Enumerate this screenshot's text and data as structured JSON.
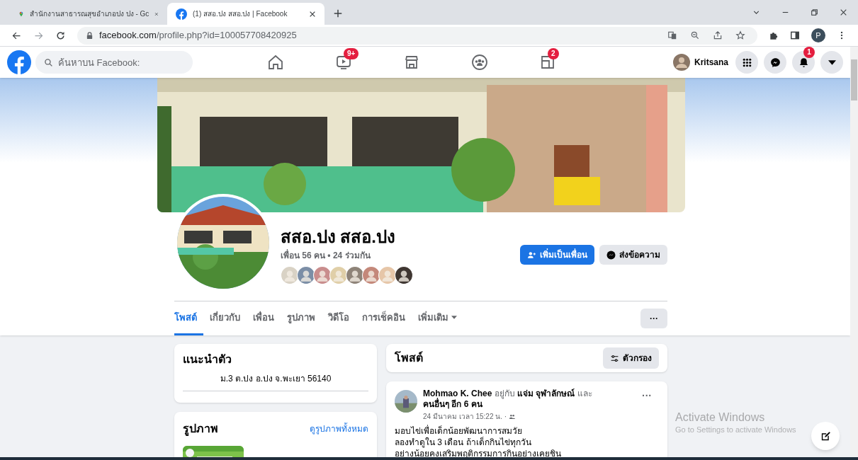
{
  "browser": {
    "tabs": [
      {
        "title": "สำนักงานสาธารณสุขอำเภอปง ปง - Gc",
        "selected": false
      },
      {
        "title": "(1) สสอ.ปง สสอ.ปง | Facebook",
        "selected": true
      }
    ],
    "url_host": "facebook.com",
    "url_path": "/profile.php?id=100057708420925",
    "profile_initial": "P"
  },
  "header": {
    "search_placeholder": "ค้นหาบน Facebook:",
    "nav": [
      {
        "kind": "home"
      },
      {
        "kind": "video",
        "badge": "9+"
      },
      {
        "kind": "store"
      },
      {
        "kind": "groups"
      },
      {
        "kind": "gaming",
        "badge": "2"
      }
    ],
    "account_name": "Kritsana",
    "actions": [
      {
        "kind": "menu"
      },
      {
        "kind": "messenger"
      },
      {
        "kind": "bell",
        "badge": "1"
      },
      {
        "kind": "caret"
      }
    ]
  },
  "profile": {
    "name": "สสอ.ปง สสอ.ปง",
    "friends": "เพื่อน 56 คน • 24 ร่วมกัน",
    "buttons": [
      {
        "kind": "primary",
        "label": "เพิ่มเป็นเพื่อน"
      },
      {
        "kind": "secondary",
        "label": "ส่งข้อความ"
      }
    ],
    "tabs": [
      {
        "label": "โพสต์",
        "selected": true
      },
      {
        "label": "เกี่ยวกับ",
        "selected": false
      },
      {
        "label": "เพื่อน",
        "selected": false
      },
      {
        "label": "รูปภาพ",
        "selected": false
      },
      {
        "label": "วิดีโอ",
        "selected": false
      },
      {
        "label": "การเช็คอิน",
        "selected": false
      },
      {
        "label": "เพิ่มเติม",
        "selected": false,
        "dropdown": true
      }
    ],
    "more": "···"
  },
  "intro": {
    "title": "แนะนำตัว",
    "address": "ม.3 ต.ปง อ.ปง จ.พะเยา 56140"
  },
  "photos": {
    "title": "รูปภาพ",
    "link": "ดูรูปภาพทั้งหมด"
  },
  "posts": {
    "title": "โพสต์",
    "filter": "ตัวกรอง"
  },
  "post": {
    "author_line": "**Mohmao K. Chee** อยู่กับ **แจ่ม จุฬาลักษณ์** และ **คนอื่นๆ อีก 6 คน**",
    "time": "24 มีนาคม เวลา 15:22 น. ·",
    "more": "···",
    "lines": [
      "มอบไข่เพื่อเด็กน้อยพัฒนาการสมวัย",
      "ลองทำดูใน 3 เดือน ถ้าเด็กกินไข่ทุกวัน",
      "อย่างน้อยคงเสริมพฤติกรรมการกินอย่างเคยชิน"
    ]
  },
  "os_notice": {
    "title": "Activate Windows",
    "text": "Go to Settings to activate Windows"
  }
}
